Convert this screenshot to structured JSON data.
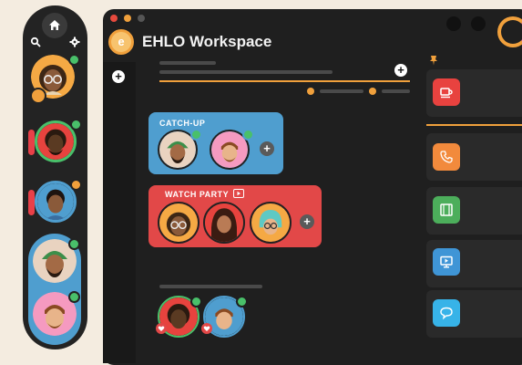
{
  "app": {
    "title": "EHLO Workspace"
  },
  "colors": {
    "background": "#f4ece0",
    "rail": "#232323",
    "window": "#1f1f1f",
    "accent_orange": "#f0a03c",
    "room_blue": "#4f9ecf",
    "room_red": "#e24848",
    "online_green": "#49c06a",
    "away_orange": "#f0a03c"
  },
  "rail": {
    "icons": [
      "home-icon",
      "search-icon",
      "gear-icon"
    ],
    "people": [
      {
        "status": "online",
        "alert": false
      },
      {
        "status": "online",
        "alert": true
      },
      {
        "status": "away",
        "alert": true
      },
      {
        "status": "online",
        "alert": false
      },
      {
        "status": "online",
        "alert": false
      }
    ]
  },
  "rooms": [
    {
      "label": "CATCH-UP",
      "color": "#4f9ecf"
    },
    {
      "label": "WATCH PARTY",
      "color": "#e24848",
      "icon": "play-icon"
    }
  ],
  "bottom_group": {
    "icons": [
      "heart-icon",
      "heart-icon"
    ]
  },
  "right_panel": {
    "pin_icon": "pin-icon",
    "tiles": [
      {
        "icon": "coffee-icon",
        "color": "#e8423f"
      },
      {
        "icon": "phone-icon",
        "color": "#f28a3c"
      },
      {
        "icon": "film-icon",
        "color": "#4cae5b"
      },
      {
        "icon": "screen-share-icon",
        "color": "#3f95d6"
      },
      {
        "icon": "chat-icon",
        "color": "#37b3e8"
      }
    ]
  },
  "plus_symbol": "+"
}
